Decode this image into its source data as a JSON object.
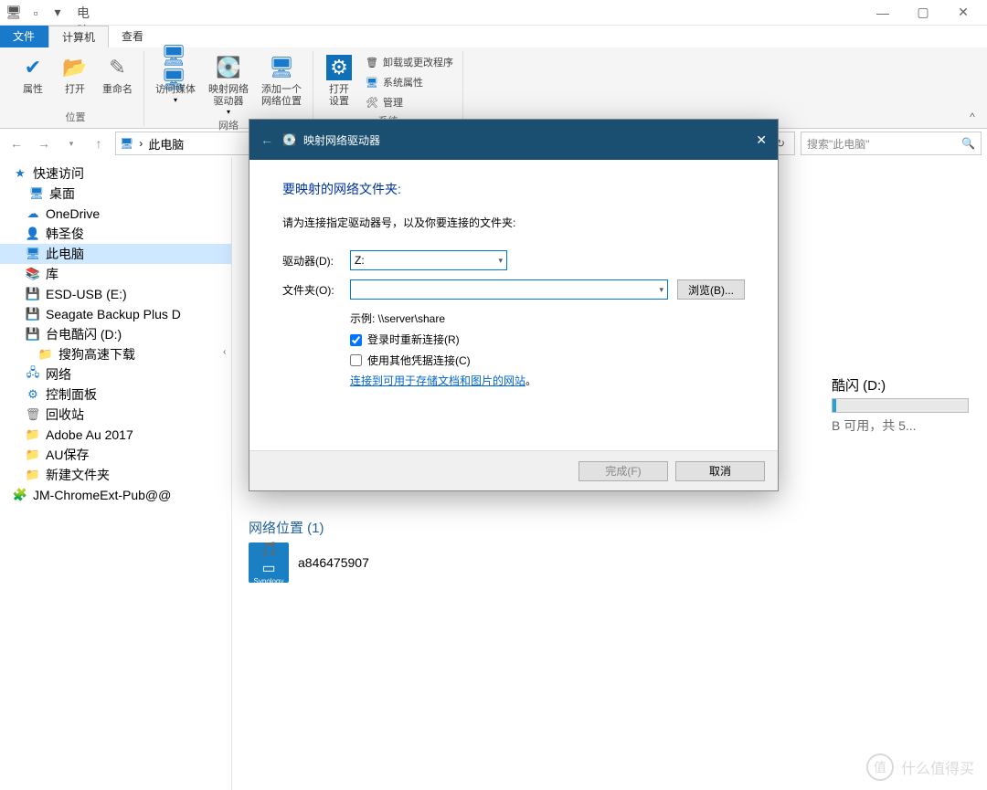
{
  "window": {
    "title": "此电脑"
  },
  "tabs": {
    "file": "文件",
    "computer": "计算机",
    "view": "查看"
  },
  "ribbon": {
    "props": "属性",
    "open": "打开",
    "rename": "重命名",
    "media": "访问媒体",
    "map_drive": "映射网络\n驱动器",
    "add_loc": "添加一个\n网络位置",
    "open_settings": "打开\n设置",
    "uninstall": "卸载或更改程序",
    "sys_props": "系统属性",
    "manage": "管理",
    "grp_location": "位置",
    "grp_network": "网络",
    "grp_system": "系统"
  },
  "address": {
    "location": "此电脑",
    "search_placeholder": "搜索\"此电脑\""
  },
  "tree": {
    "quick": "快速访问",
    "desktop": "桌面",
    "onedrive": "OneDrive",
    "user": "韩圣俊",
    "thispc": "此电脑",
    "libraries": "库",
    "esd": "ESD-USB (E:)",
    "seagate": "Seagate Backup Plus D",
    "taidian": "台电酷闪 (D:)",
    "sogou": "搜狗高速下载",
    "network": "网络",
    "control": "控制面板",
    "recycle": "回收站",
    "adobe": "Adobe Au 2017",
    "au": "AU保存",
    "newfolder": "新建文件夹",
    "jm": "JM-ChromeExt-Pub@@"
  },
  "main": {
    "drive_name": "酷闪 (D:)",
    "drive_info": "B 可用，共 5...",
    "netloc_header": "网络位置 (1)",
    "netloc_name": "a846475907",
    "netloc_brand": "Synology"
  },
  "dialog": {
    "title": "映射网络驱动器",
    "heading": "要映射的网络文件夹:",
    "instruction": "请为连接指定驱动器号，以及你要连接的文件夹:",
    "drive_label": "驱动器(D):",
    "drive_value": "Z:",
    "folder_label": "文件夹(O):",
    "folder_value": "",
    "browse": "浏览(B)...",
    "example": "示例: \\\\server\\share",
    "reconnect": "登录时重新连接(R)",
    "other_cred": "使用其他凭据连接(C)",
    "link": "连接到可用于存储文档和图片的网站",
    "finish": "完成(F)",
    "cancel": "取消"
  },
  "watermark": "什么值得买"
}
